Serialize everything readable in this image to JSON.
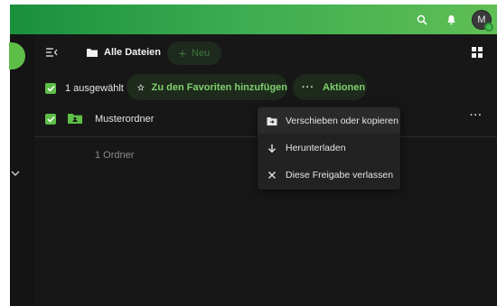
{
  "header": {
    "icons": [
      "search-icon",
      "notification-bell-icon"
    ],
    "avatar_initial": "M",
    "accent_gradient": [
      "#1a8f3c",
      "#5fbf55"
    ]
  },
  "breadcrumb": {
    "label": "Alle Dateien",
    "new_button": "Neu"
  },
  "selection_bar": {
    "count_label": "1 ausgewählt",
    "favorites_button": "Zu den Favoriten hinzufügen",
    "actions_button": "Aktionen"
  },
  "files": [
    {
      "name": "Musterordner",
      "type": "folder",
      "selected": true
    }
  ],
  "summary": "1 Ordner",
  "actions_menu": {
    "items": [
      {
        "label": "Verschieben oder kopieren",
        "icon": "folder-move-icon"
      },
      {
        "label": "Herunterladen",
        "icon": "download-icon"
      },
      {
        "label": "Diese Freigabe verlassen",
        "icon": "close-icon"
      }
    ]
  },
  "colors": {
    "accent": "#5dbf48",
    "background": "#171717",
    "menu": "#222222"
  }
}
